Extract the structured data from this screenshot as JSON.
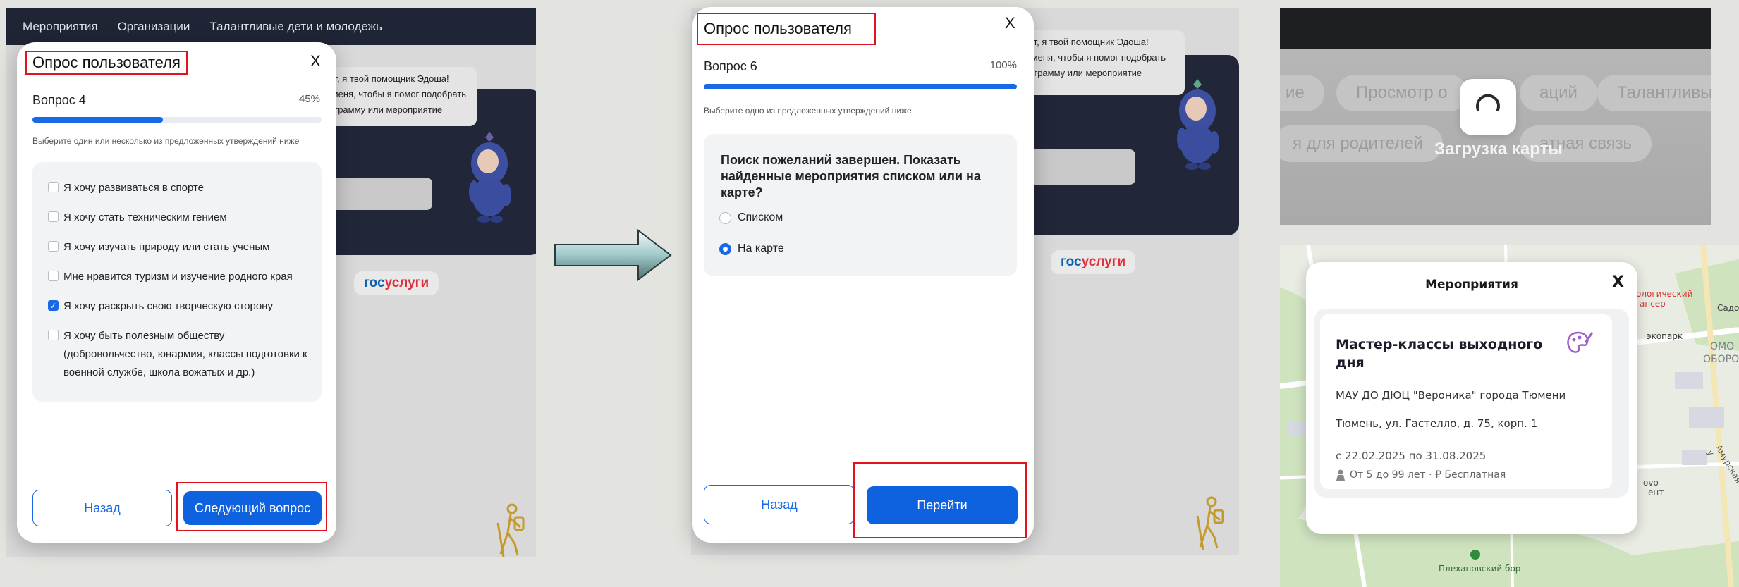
{
  "left": {
    "nav": [
      "Мероприятия",
      "Организации",
      "Талантливые дети и молодежь"
    ],
    "bubble": "вет, я твой помощник Эдоша!\nя меня, чтобы я помог подобрать\nрограмму или мероприятие",
    "gos": {
      "a": "гос",
      "b": "услуги"
    },
    "modal": {
      "title": "Опрос пользователя",
      "close": "X",
      "question": "Вопрос 4",
      "percent": "45%",
      "progress": 0.45,
      "hint": "Выберите один или несколько из предложенных утверждений ниже",
      "options": [
        {
          "label": "Я хочу развиваться в спорте",
          "checked": false
        },
        {
          "label": "Я хочу стать техническим гением",
          "checked": false
        },
        {
          "label": "Я хочу изучать природу или стать ученым",
          "checked": false
        },
        {
          "label": "Мне нравится туризм и изучение родного края",
          "checked": false
        },
        {
          "label": "Я хочу раскрыть свою творческую сторону",
          "checked": true
        }
      ],
      "option6_lines": [
        "Я хочу быть полезным обществу",
        "(добровольчество, юнармия, классы подготовки к",
        "военной службе, школа вожатых и др.)"
      ],
      "back": "Назад",
      "next": "Следующий вопрос"
    }
  },
  "mid": {
    "bubble": "вет, я твой помощник Эдоша!\nя меня, чтобы я помог подобрать\nрограмму или мероприятие",
    "gos": {
      "a": "гос",
      "b": "услуги"
    },
    "modal": {
      "title": "Опрос пользователя",
      "close": "X",
      "question": "Вопрос 6",
      "percent": "100%",
      "progress": 1.0,
      "hint": "Выберите одно из предложенных утверждений ниже",
      "prompt_lines": [
        "Поиск пожеланий завершен. Показать",
        "найденные мероприятия списком или на",
        "карте?"
      ],
      "radio1": "Списком",
      "radio2": "На карте",
      "back": "Назад",
      "go": "Перейти"
    }
  },
  "loading": {
    "text": "Загрузка карты",
    "chips": [
      "ие",
      "Просмотр о",
      "аций",
      "Талантливые",
      "я для родителей",
      "атная связь"
    ]
  },
  "map": {
    "panel_title": "Мероприятия",
    "close": "X",
    "event_title_lines": [
      "Мастер-классы выходного",
      "дня"
    ],
    "org": "МАУ ДО ДЮЦ \"Вероника\" города Тюмени",
    "address": "Тюмень, ул. Гастелло, д. 75, корп. 1",
    "dates": "с 22.02.2025 по 31.08.2025",
    "age_price": "От 5 до 99 лет · ₽ Бесплатная",
    "labels": {
      "top": "ологический",
      "top2": "ансер",
      "park": "экопарк",
      "sad": "Садо",
      "obor": "ОБОРО",
      "omo": "ОМО",
      "amur": "Амурская у",
      "bor": "Плехановский бор",
      "vo": "ovo",
      "ent": "ент"
    }
  },
  "colors": {
    "primary": "#0f62df",
    "highlight": "#e0141e",
    "dark": "#212739"
  }
}
